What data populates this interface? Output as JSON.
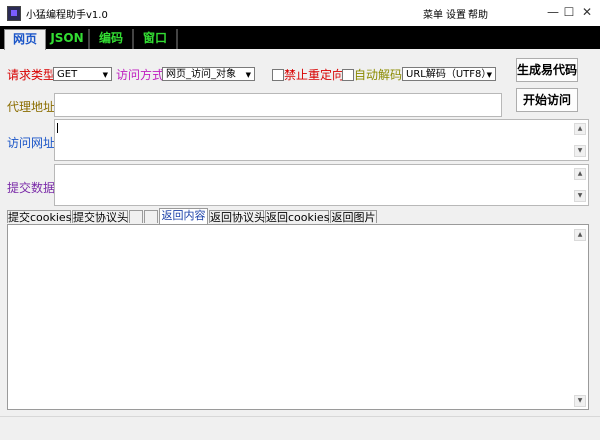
{
  "window": {
    "title": "小猛编程助手v1.0",
    "menu": [
      "菜单",
      "设置",
      "帮助"
    ],
    "controls": {
      "minimize": "—",
      "maximize": "☐",
      "close": "✕"
    }
  },
  "top_tabs": [
    {
      "label": "网页",
      "active": true
    },
    {
      "label": "JSON",
      "active": false
    },
    {
      "label": "编码",
      "active": false
    },
    {
      "label": "窗口",
      "active": false
    }
  ],
  "request": {
    "method_label": "请求类型",
    "method_value": "GET",
    "access_label": "访问方式",
    "access_value": "网页_访问_对象",
    "no_redirect_label": "禁止重定向",
    "auto_decode_label": "自动解码",
    "decode_value": "URL解码（UTF8）",
    "generate_button": "生成易代码",
    "proxy_label": "代理地址",
    "proxy_value": "",
    "start_button": "开始访问",
    "url_label": "访问网址",
    "url_value": "",
    "post_label": "提交数据",
    "post_value": ""
  },
  "bottom_tabs": [
    {
      "label": "提交cookies",
      "active": false
    },
    {
      "label": "提交协议头",
      "active": false
    },
    {
      "label": "",
      "active": false
    },
    {
      "label": "",
      "active": false
    },
    {
      "label": "返回内容",
      "active": true
    },
    {
      "label": "返回协议头",
      "active": false
    },
    {
      "label": "返回cookies",
      "active": false
    },
    {
      "label": "返回图片",
      "active": false
    }
  ],
  "response": {
    "content": ""
  },
  "colors": {
    "method_label": "#d80000",
    "access_label": "#c020c0",
    "proxy_label": "#8b6d00",
    "url_label": "#1a55c8",
    "post_label": "#7a2aa8",
    "tab_green": "#33dd33",
    "tab_active": "#1a55c8"
  }
}
